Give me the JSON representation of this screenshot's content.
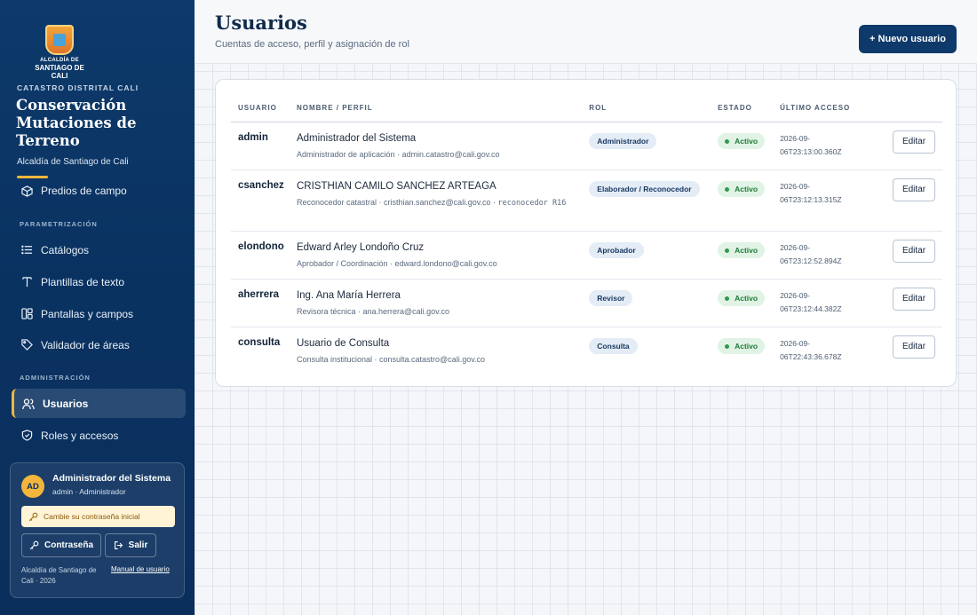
{
  "sidebar": {
    "logo_line1": "ALCALDÍA DE",
    "logo_line2": "SANTIAGO DE CALI",
    "eyebrow": "CATASTRO DISTRITAL CALI",
    "title": "Conservación Mutaciones de Terreno",
    "subtitle": "Alcaldía de Santiago de Cali",
    "partial_item": "Predios de campo",
    "section_param": "PARAMETRIZACIÓN",
    "param_items": [
      {
        "label": "Catálogos",
        "icon": "list-icon"
      },
      {
        "label": "Plantillas de texto",
        "icon": "text-icon"
      },
      {
        "label": "Pantallas y campos",
        "icon": "layout-icon"
      },
      {
        "label": "Validador de áreas",
        "icon": "tag-icon"
      }
    ],
    "section_admin": "ADMINISTRACIÓN",
    "admin_items": [
      {
        "label": "Usuarios",
        "icon": "users-icon",
        "active": true
      },
      {
        "label": "Roles y accesos",
        "icon": "shield-icon",
        "active": false
      }
    ],
    "user": {
      "initials": "AD",
      "name": "Administrador del Sistema",
      "role": "admin · Administrador",
      "warning": "Cambie su contraseña inicial",
      "password_button": "Contraseña",
      "logout_button": "Salir",
      "footer": "Alcaldía de Santiago de Cali · 2026",
      "manual_link": "Manual de usuario"
    }
  },
  "header": {
    "title": "Usuarios",
    "subtitle": "Cuentas de acceso, perfil y asignación de rol",
    "new_user_button": "+ Nuevo usuario"
  },
  "table": {
    "columns": [
      "USUARIO",
      "NOMBRE / PERFIL",
      "ROL",
      "ESTADO",
      "ÚLTIMO ACCESO",
      ""
    ],
    "edit_label": "Editar",
    "rows": [
      {
        "username": "admin",
        "full_name": "Administrador del Sistema",
        "profile": "Administrador de aplicación · admin.catastro@cali.gov.co",
        "profile_code": "",
        "role": "Administrador",
        "status": "Activo",
        "last_access_1": "2026-09-",
        "last_access_2": "06T23:13:00.360Z"
      },
      {
        "username": "csanchez",
        "full_name": "CRISTHIAN CAMILO SANCHEZ ARTEAGA",
        "profile": "Reconocedor catastral · cristhian.sanchez@cali.gov.co · ",
        "profile_code": "reconocedor R16",
        "role": "Elaborador / Reconocedor",
        "status": "Activo",
        "last_access_1": "2026-09-",
        "last_access_2": "06T23:12:13.315Z"
      },
      {
        "username": "elondono",
        "full_name": "Edward Arley Londoño Cruz",
        "profile": "Aprobador / Coordinación · edward.londono@cali.gov.co",
        "profile_code": "",
        "role": "Aprobador",
        "status": "Activo",
        "last_access_1": "2026-09-",
        "last_access_2": "06T23:12:52.894Z"
      },
      {
        "username": "aherrera",
        "full_name": "Ing. Ana María Herrera",
        "profile": "Revisora técnica · ana.herrera@cali.gov.co",
        "profile_code": "",
        "role": "Revisor",
        "status": "Activo",
        "last_access_1": "2026-09-",
        "last_access_2": "06T23:12:44.382Z"
      },
      {
        "username": "consulta",
        "full_name": "Usuario de Consulta",
        "profile": "Consulta institucional · consulta.catastro@cali.gov.co",
        "profile_code": "",
        "role": "Consulta",
        "status": "Activo",
        "last_access_1": "2026-09-",
        "last_access_2": "06T22:43:36.678Z"
      }
    ]
  },
  "colors": {
    "sidebar_bg": "#0b2f5c",
    "accent_gold": "#f2b63d",
    "primary_button": "#0d3a6b",
    "status_active": "#1f7a3b"
  }
}
